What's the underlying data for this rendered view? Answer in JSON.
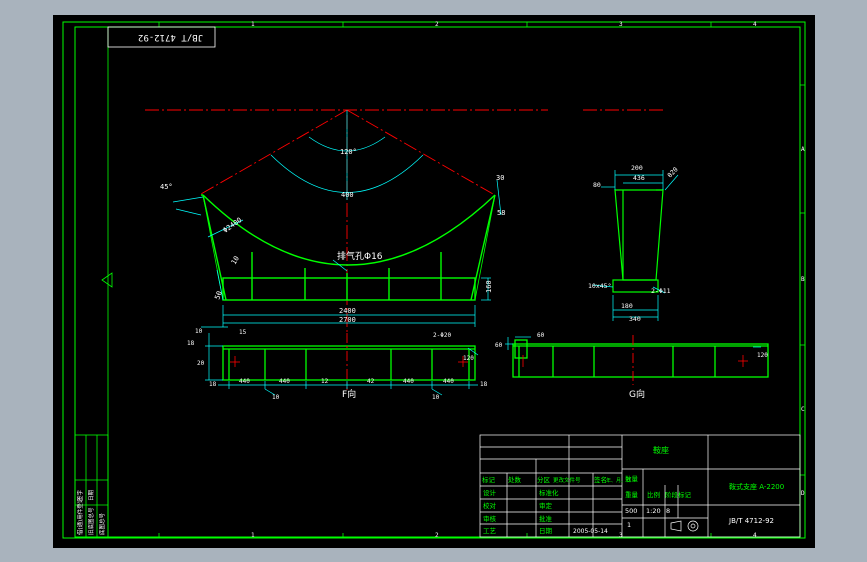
{
  "drawing": {
    "code_box": "JB/T 4712-92",
    "view_f_label": "F向",
    "view_g_label": "G向",
    "border_numbers": {
      "top": [
        "1",
        "2",
        "3",
        "4"
      ],
      "bottom": [
        "1",
        "2",
        "3",
        "4"
      ],
      "right": [
        "A",
        "B",
        "C",
        "D"
      ]
    },
    "colors": {
      "background": "#000000",
      "border": "#00ff00",
      "dimension": "#00ffff",
      "center_line": "#ff0000",
      "outline": "#00ff00",
      "text": "#ffffff"
    }
  },
  "dimensions": {
    "angle": "120°",
    "r400": "400",
    "bevel": "45°",
    "top_right_small": "30",
    "right_side": "58",
    "slant": "10",
    "arc_radius": "Φ2400",
    "hole_note": "排气孔Φ16",
    "height_right": "160",
    "base_left_height": "50",
    "span_inner": "2400",
    "span_outer": "2700",
    "g_top": "200",
    "g_top2": "436",
    "g_top_left": "80",
    "g_angle": "θ20",
    "g_chamfer": "10x45°",
    "g_hole": "2-Φ11",
    "g_bottom1": "180",
    "g_bottom2": "340",
    "f_left_vals": [
      "10",
      "18",
      "20"
    ],
    "f_top_left": "15",
    "f_holes_note": "2-Φ20",
    "f_bottom": [
      "18",
      "440",
      "440",
      "12",
      "42",
      "440",
      "440",
      "18"
    ],
    "f_bottom_sub": [
      "10",
      "10"
    ],
    "f_right": "120",
    "g_view_left": "60",
    "g_view_right": "120",
    "g_view_top": "60"
  },
  "title_block": {
    "drawing_name": "鞍座",
    "part_title": "鞍式支座 A-2200",
    "code": "JB/T 4712-92",
    "header_cells": [
      "标记",
      "处数",
      "分区",
      "更改文件号",
      "签名",
      "年、月、日"
    ],
    "rows": [
      {
        "label": "设计",
        "col2": "",
        "col3": "标准化"
      },
      {
        "label": "校对",
        "col2": "",
        "col3": "审定"
      },
      {
        "label": "审核",
        "col2": "",
        "col3": "批准"
      },
      {
        "label": "工艺",
        "col2": "",
        "col3": "日期",
        "date": "2005-05-14"
      }
    ],
    "stage_label": "阶段标记",
    "weight_label": "重量",
    "scale_label": "比例",
    "weight_value": "500",
    "scale_value": "1:20",
    "sheet_label": "共 张 第 张",
    "sheet_values": [
      "1",
      "8"
    ],
    "qty_label": "数量"
  },
  "side_strip": [
    "借(通)用件登记",
    "旧底图总号",
    "底图总号",
    "签字",
    "日期"
  ]
}
